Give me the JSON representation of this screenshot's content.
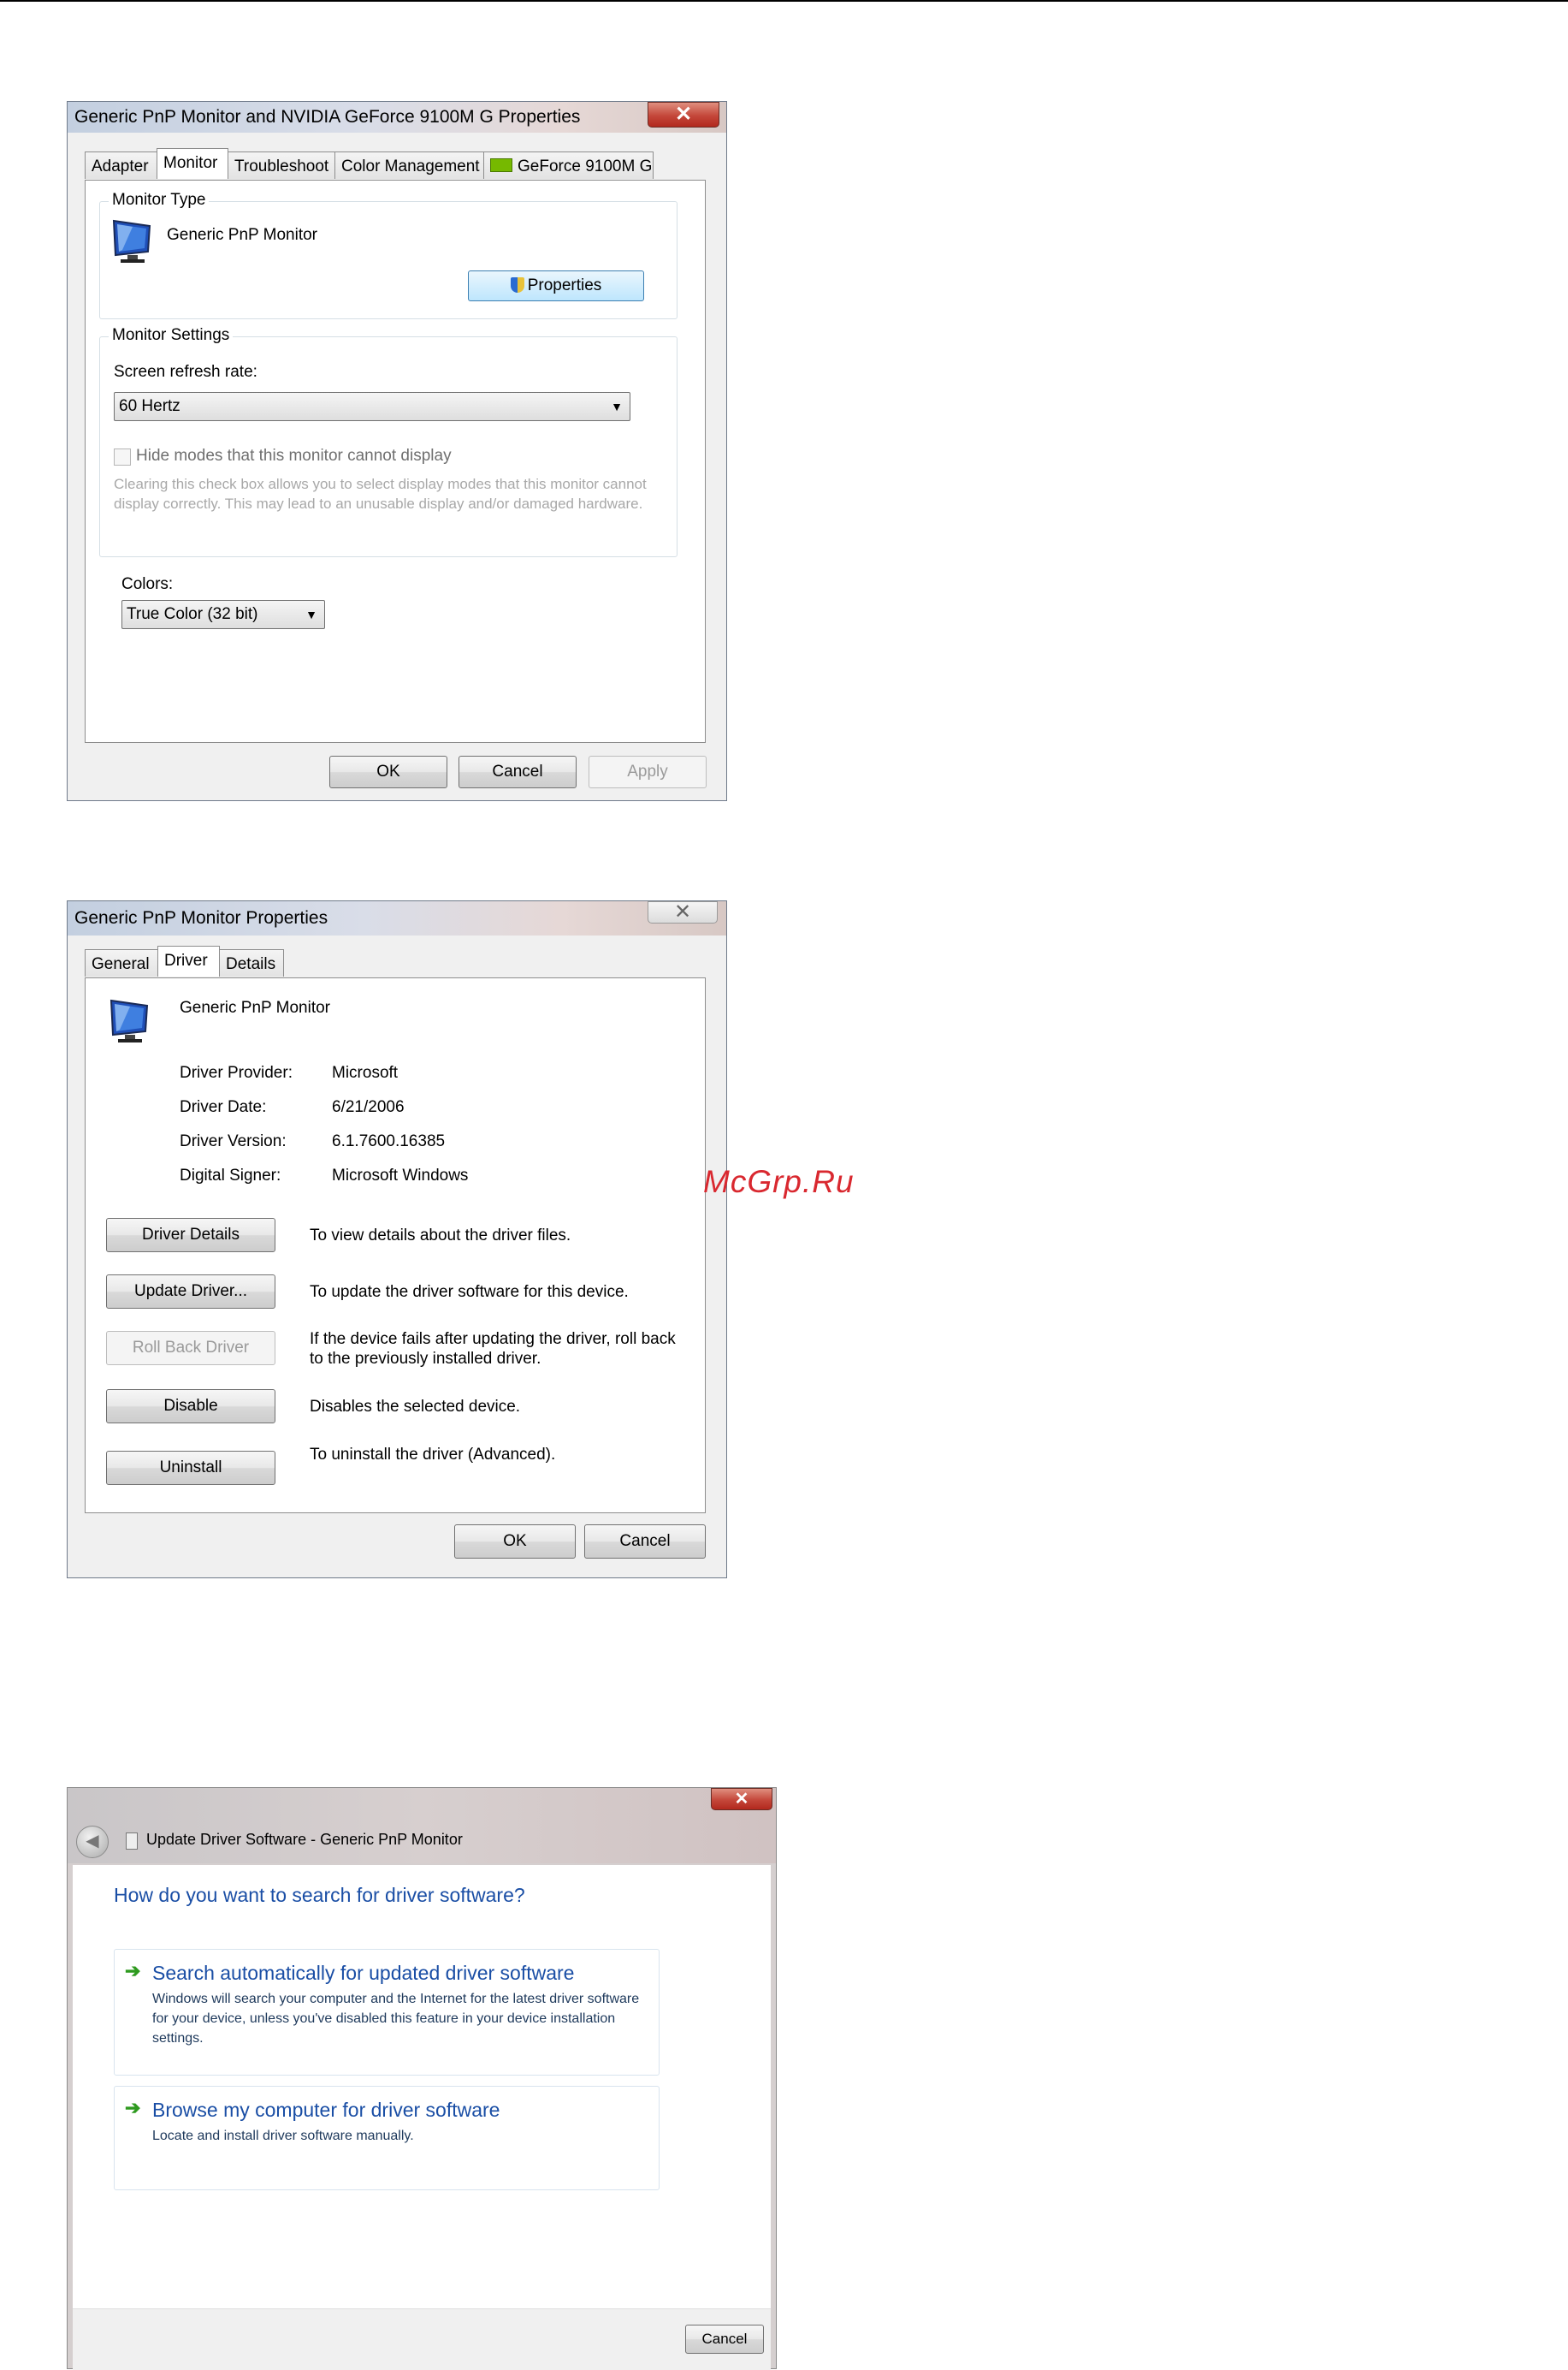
{
  "watermark": "McGrp.Ru",
  "dialog1": {
    "title": "Generic PnP Monitor and NVIDIA GeForce 9100M G   Properties",
    "tabs": [
      "Adapter",
      "Monitor",
      "Troubleshoot",
      "Color Management",
      "GeForce 9100M G"
    ],
    "active_tab": "Monitor",
    "monitor_type_label": "Monitor Type",
    "monitor_name": "Generic PnP Monitor",
    "properties_button": "Properties",
    "monitor_settings_label": "Monitor Settings",
    "refresh_rate_label": "Screen refresh rate:",
    "refresh_rate_value": "60 Hertz",
    "hide_modes_label": "Hide modes that this monitor cannot display",
    "hide_modes_desc": "Clearing this check box allows you to select display modes that this monitor cannot display correctly. This may lead to an unusable display and/or damaged hardware.",
    "colors_label": "Colors:",
    "colors_value": "True Color (32 bit)",
    "ok": "OK",
    "cancel": "Cancel",
    "apply": "Apply"
  },
  "dialog2": {
    "title": "Generic PnP Monitor Properties",
    "tabs": [
      "General",
      "Driver",
      "Details"
    ],
    "active_tab": "Driver",
    "device_name": "Generic PnP Monitor",
    "info": [
      {
        "label": "Driver Provider:",
        "value": "Microsoft"
      },
      {
        "label": "Driver Date:",
        "value": "6/21/2006"
      },
      {
        "label": "Driver Version:",
        "value": "6.1.7600.16385"
      },
      {
        "label": "Digital Signer:",
        "value": "Microsoft Windows"
      }
    ],
    "actions": [
      {
        "button": "Driver Details",
        "desc": "To view details about the driver files."
      },
      {
        "button": "Update Driver...",
        "desc": "To update the driver software for this device."
      },
      {
        "button": "Roll Back Driver",
        "desc": "If the device fails after updating the driver, roll back to the previously installed driver."
      },
      {
        "button": "Disable",
        "desc": "Disables the selected device."
      },
      {
        "button": "Uninstall",
        "desc": "To uninstall the driver (Advanced)."
      }
    ],
    "ok": "OK",
    "cancel": "Cancel"
  },
  "wizard": {
    "title": "Update Driver Software - Generic PnP Monitor",
    "question": "How do you want to search for driver software?",
    "option1_title": "Search automatically for updated driver software",
    "option1_desc": "Windows will search your computer and the Internet for the latest driver software for your device, unless you've disabled this feature in your device installation settings.",
    "option2_title": "Browse my computer for driver software",
    "option2_desc": "Locate and install driver software manually.",
    "cancel": "Cancel"
  },
  "colors": {
    "accent_blue": "#1a4ea5",
    "green_arrow": "#2e9a1f",
    "close_red": "#c4473a"
  }
}
